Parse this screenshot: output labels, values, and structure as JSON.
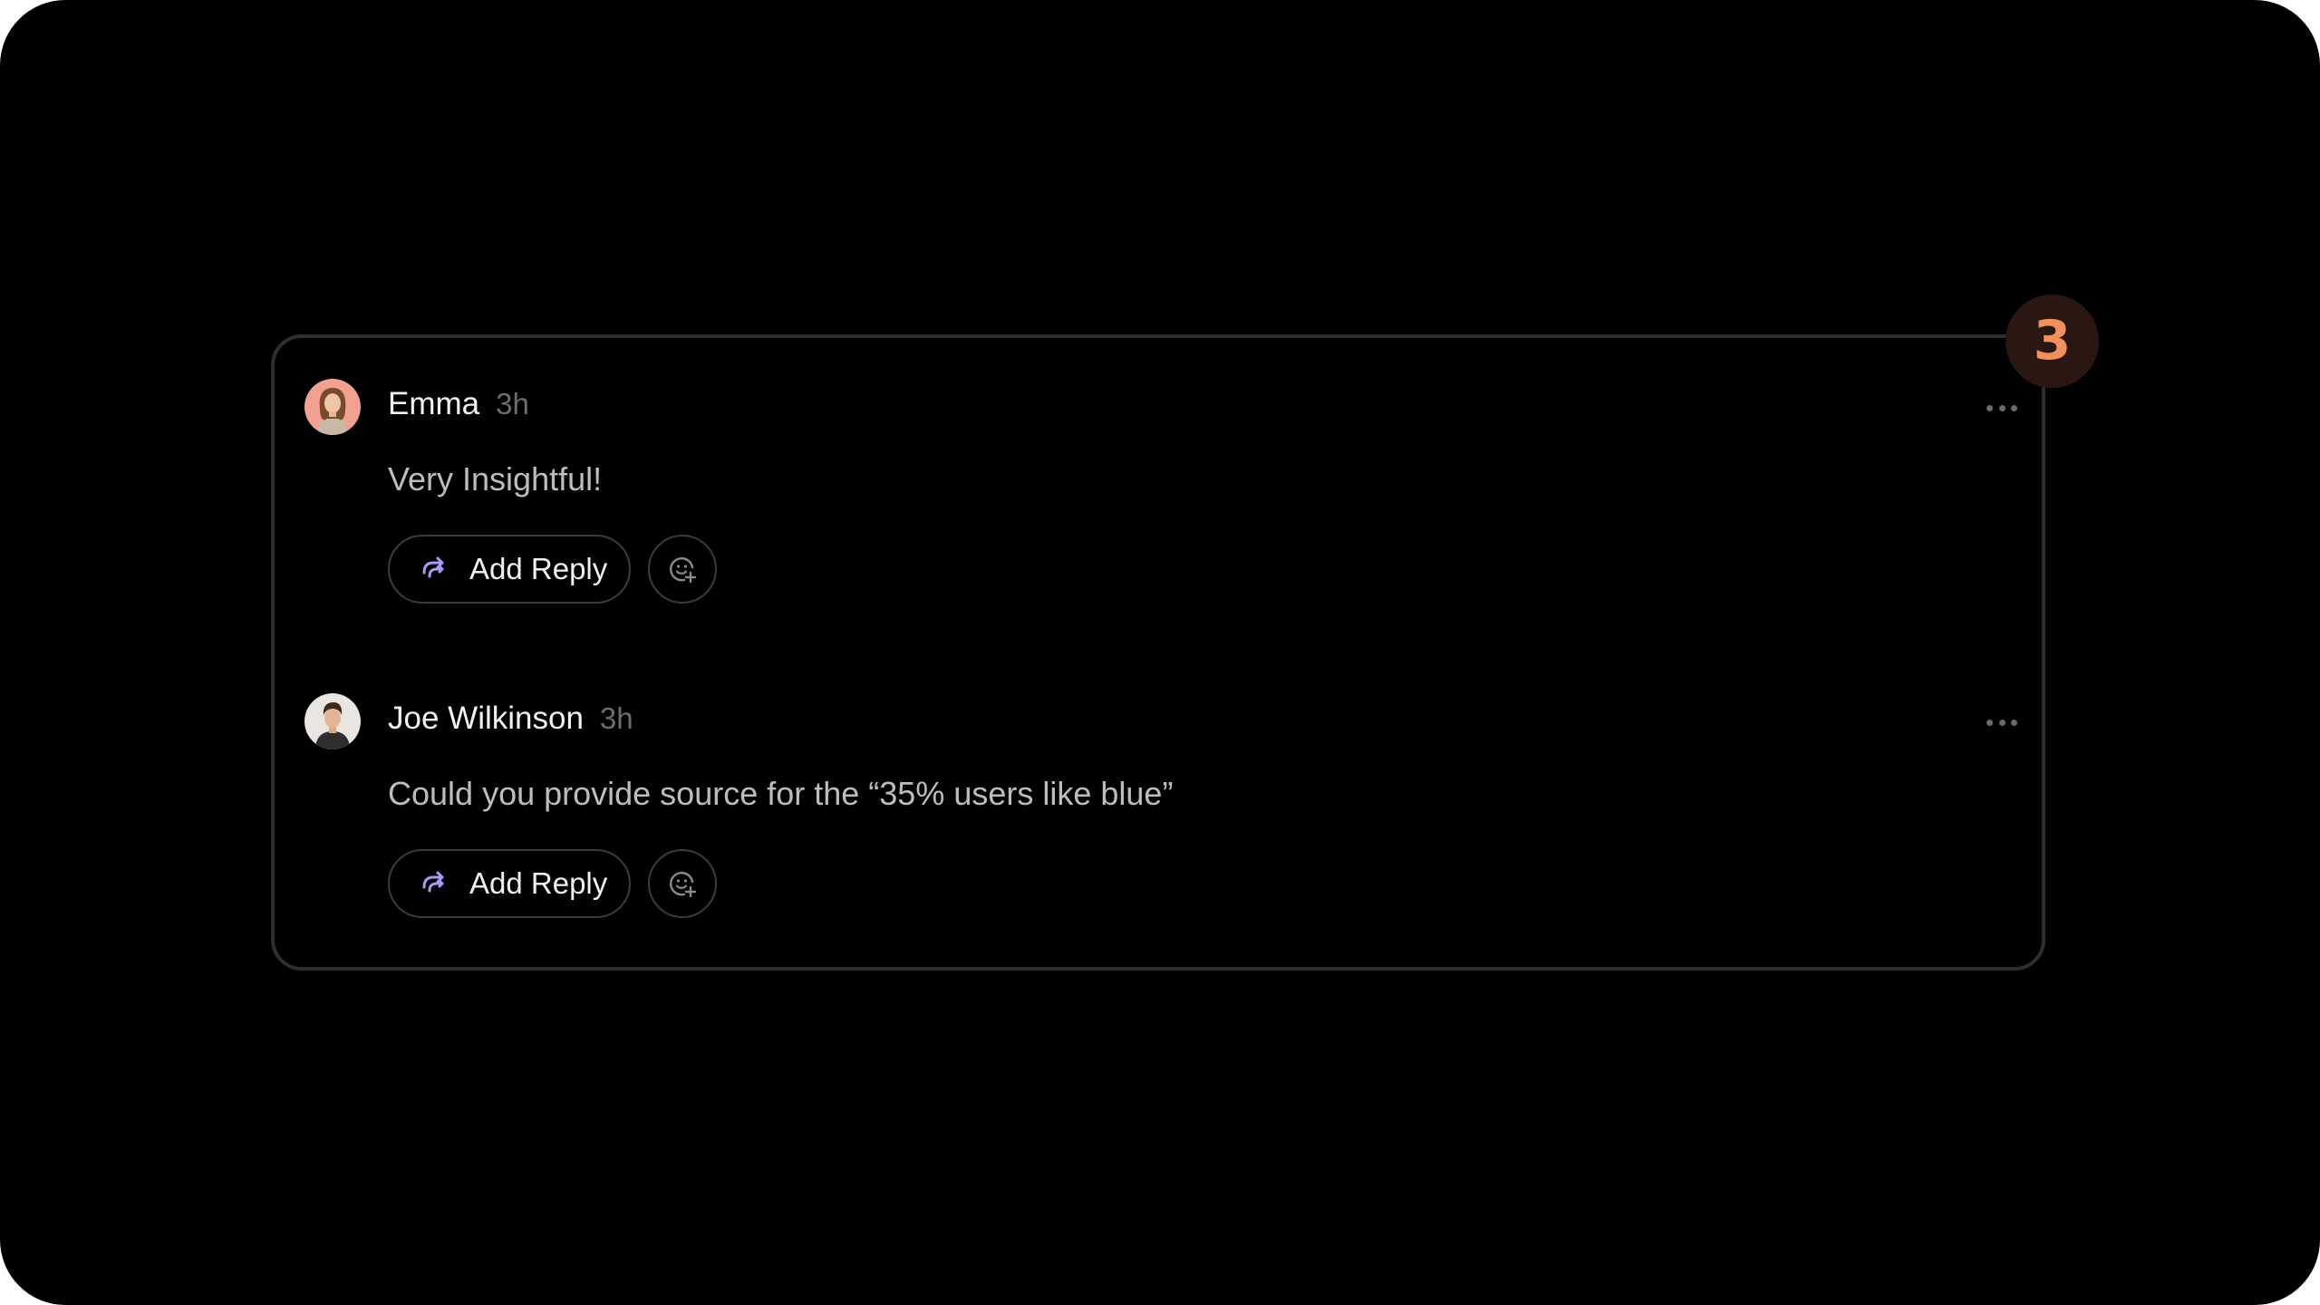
{
  "thread": {
    "comment_count_badge": "3",
    "comments": [
      {
        "author": "Emma",
        "time": "3h",
        "text": "Very Insightful!",
        "reply_label": "Add Reply",
        "avatar_icon": "emma-avatar"
      },
      {
        "author": "Joe Wilkinson",
        "time": "3h",
        "text": "Could you provide source for the “35% users like blue”",
        "reply_label": "Add Reply",
        "avatar_icon": "joe-avatar"
      }
    ]
  },
  "colors": {
    "background": "#000000",
    "card_border": "#2e2e2e",
    "badge_bg": "#2a1711",
    "badge_text": "#f0905a",
    "reply_icon": "#a79cf5",
    "muted_text": "#6d6d6d"
  }
}
